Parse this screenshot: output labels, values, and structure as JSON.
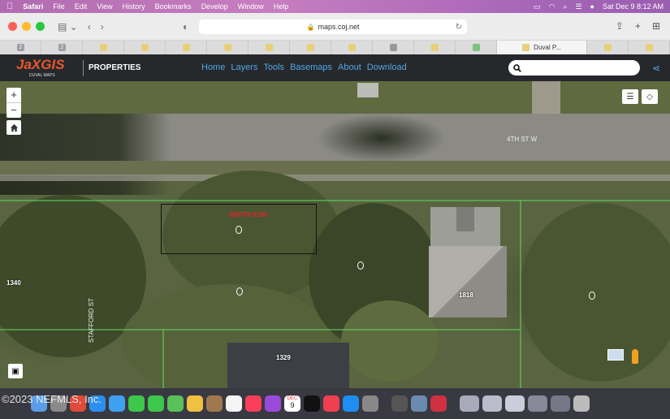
{
  "menubar": {
    "app": "Safari",
    "items": [
      "File",
      "Edit",
      "View",
      "History",
      "Bookmarks",
      "Develop",
      "Window",
      "Help"
    ],
    "datetime": "Sat Dec 9  8:12 AM"
  },
  "browser": {
    "url": "maps.coj.net",
    "active_tab": "Duval P..."
  },
  "app": {
    "logo": "JaXGIS",
    "logo_sub": "DUVAL MAPS",
    "section": "PROPERTIES",
    "nav": [
      "Home",
      "Layers",
      "Tools",
      "Basemaps",
      "About",
      "Download"
    ],
    "search_placeholder": ""
  },
  "map": {
    "street_label": "4TH ST W",
    "side_street_label": "STAFFORD ST",
    "parcel_id": "050776 0100",
    "house_numbers": [
      "1340",
      "1818",
      "1329"
    ]
  },
  "watermark": "©2023 NEFMLS, Inc.",
  "dock": {
    "calendar_month": "DEC",
    "calendar_day": "9"
  }
}
